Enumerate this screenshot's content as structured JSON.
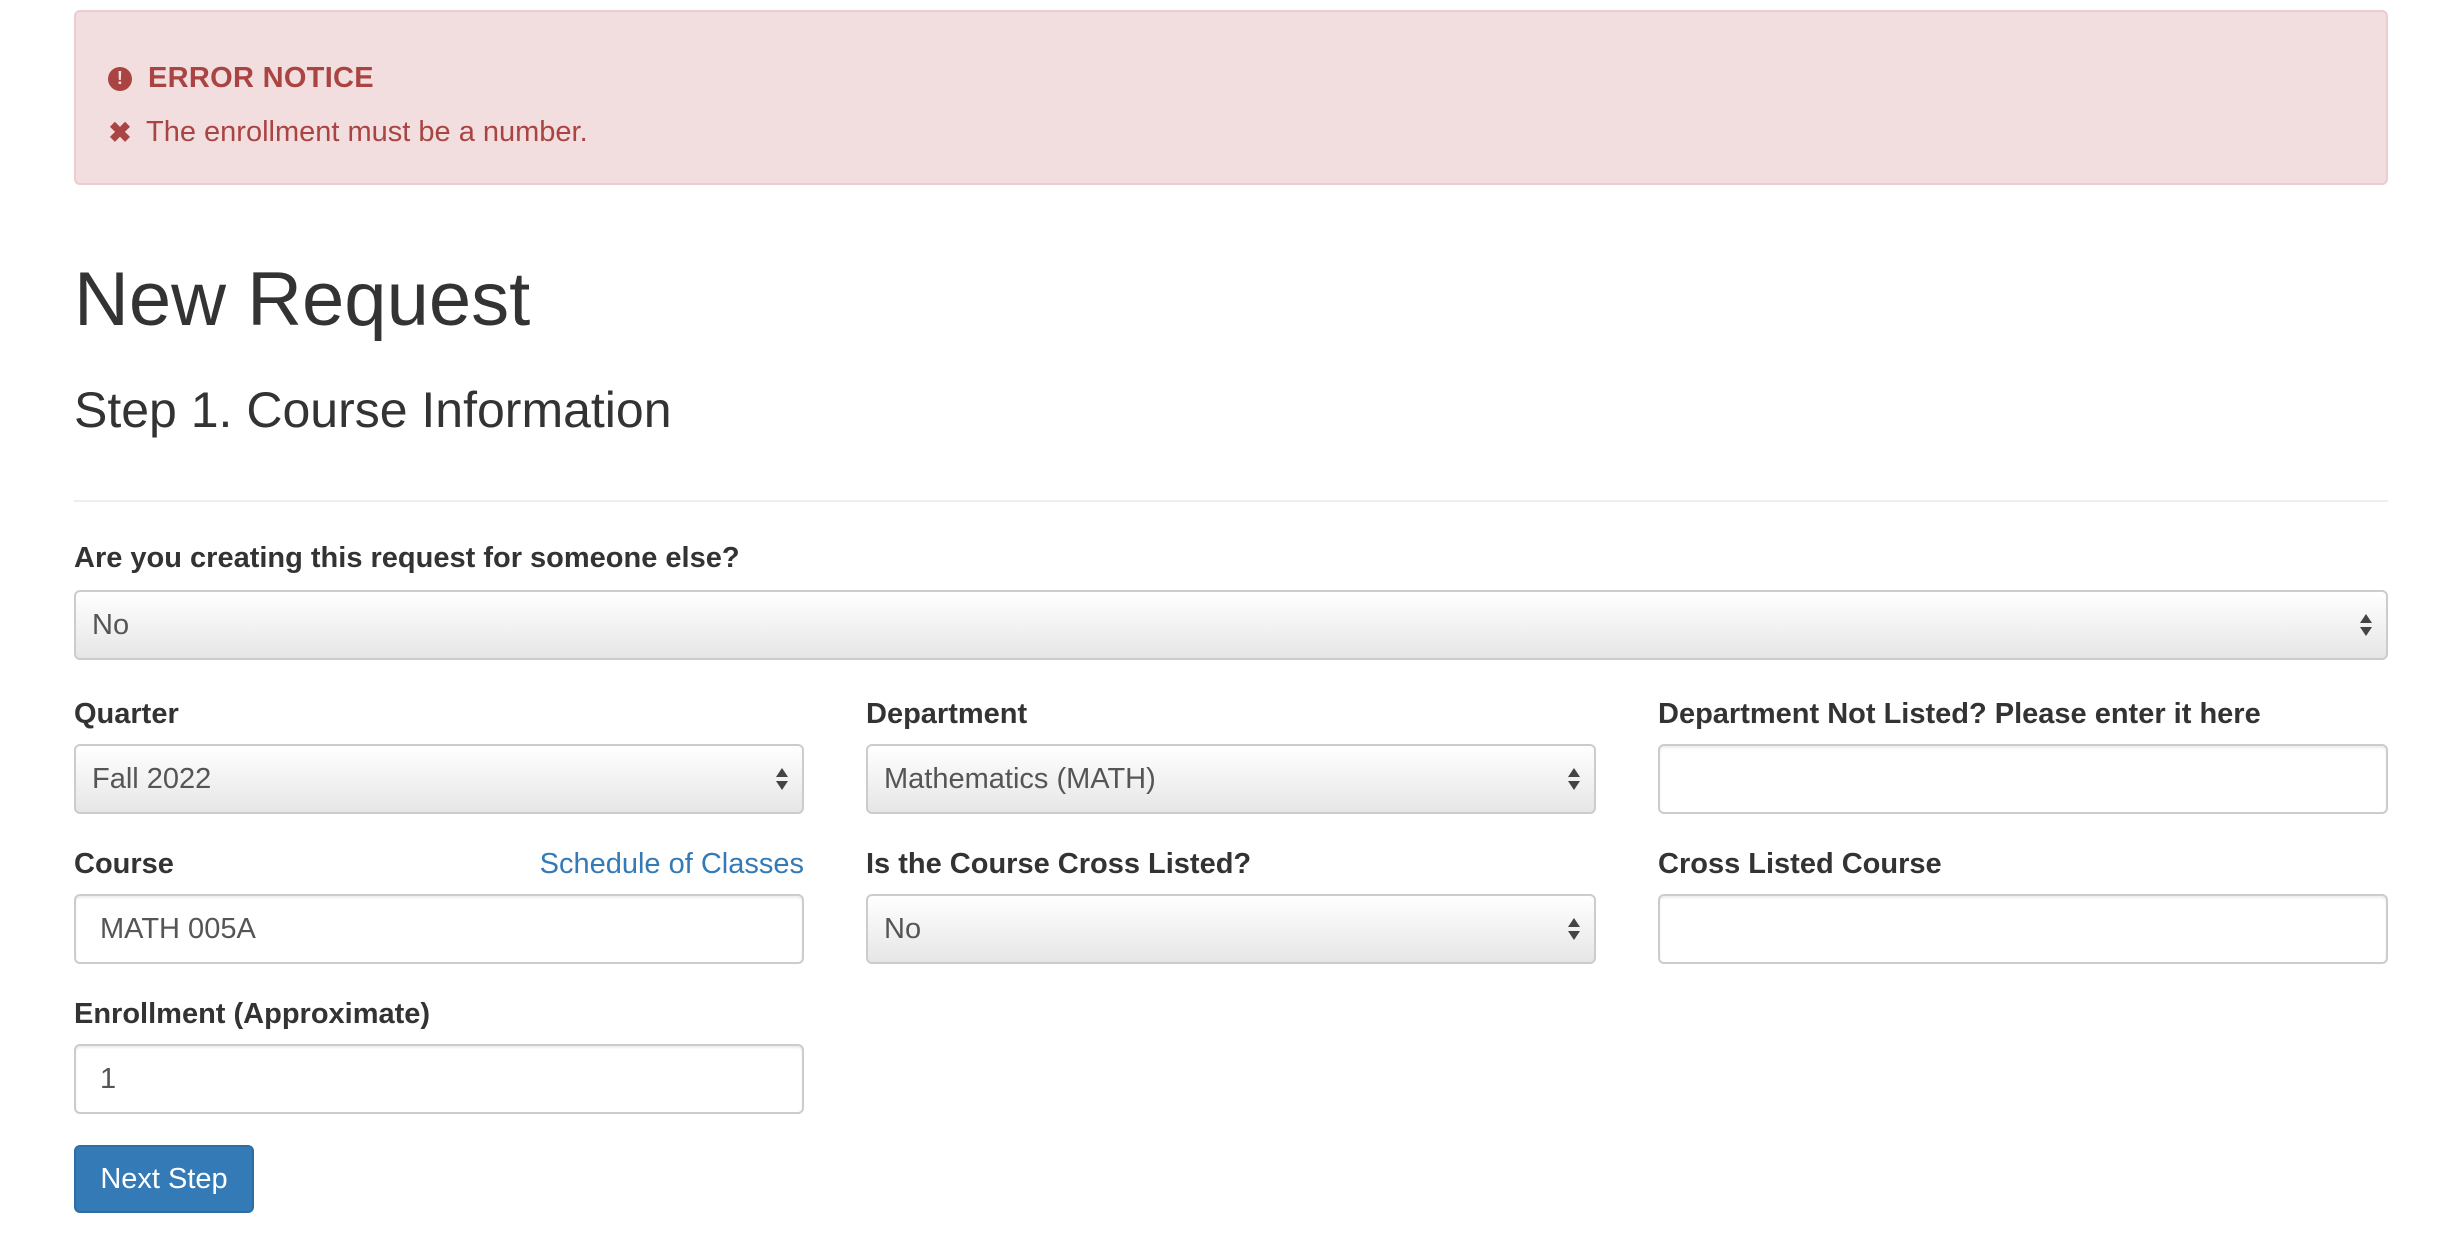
{
  "alert": {
    "title": "ERROR NOTICE",
    "message": "The enrollment must be a number.",
    "icon_title": "exclamation-circle-icon",
    "icon_message": "times-icon",
    "color": "#a94442",
    "background": "#f2dede"
  },
  "page": {
    "title": "New Request",
    "subtitle": "Step 1. Course Information"
  },
  "form": {
    "someone_else": {
      "label": "Are you creating this request for someone else?",
      "value": "No"
    },
    "quarter": {
      "label": "Quarter",
      "value": "Fall 2022"
    },
    "department": {
      "label": "Department",
      "value": "Mathematics (MATH)"
    },
    "dept_not_listed": {
      "label": "Department Not Listed? Please enter it here",
      "value": ""
    },
    "course": {
      "label": "Course",
      "value": "MATH 005A",
      "link": "Schedule of Classes"
    },
    "cross_listed": {
      "label": "Is the Course Cross Listed?",
      "value": "No"
    },
    "cross_listed_course": {
      "label": "Cross Listed Course",
      "value": ""
    },
    "enrollment": {
      "label": "Enrollment (Approximate)",
      "value": "1"
    },
    "next_button": "Next Step"
  },
  "colors": {
    "primary": "#337ab7",
    "link": "#337ab7",
    "text": "#333333"
  }
}
